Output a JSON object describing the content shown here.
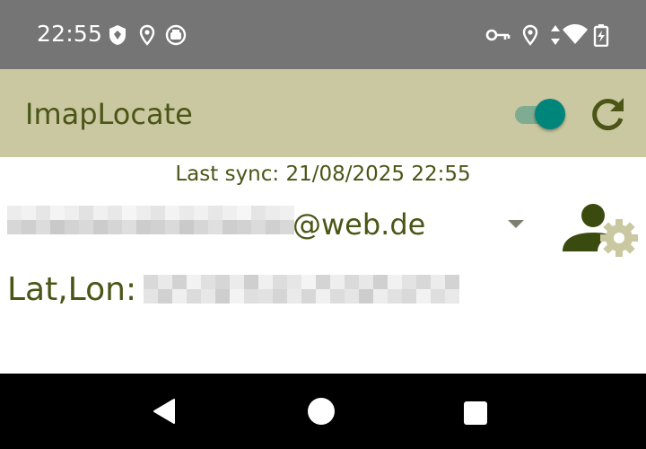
{
  "status_bar": {
    "time": "22:55",
    "left_icons": [
      "shield-icon",
      "location-pin-icon",
      "app-badge-icon"
    ],
    "right_icons": [
      "vpn-key-icon",
      "location-pin-icon",
      "data-transfer-icon",
      "wifi-icon",
      "battery-charging-icon"
    ]
  },
  "app_bar": {
    "title": "ImapLocate",
    "toggle_on": true,
    "colors": {
      "background": "#c9c8a1",
      "title": "#4a5516",
      "toggle_thumb": "#00857a",
      "toggle_track": "#7fab93"
    }
  },
  "content": {
    "sync_text": "Last sync: 21/08/2025 22:55",
    "account": {
      "visible_suffix": "@web.de"
    },
    "latlon_label": "Lat,Lon:"
  },
  "nav_bar": {
    "buttons": [
      "back-icon",
      "home-icon",
      "recents-icon"
    ]
  }
}
